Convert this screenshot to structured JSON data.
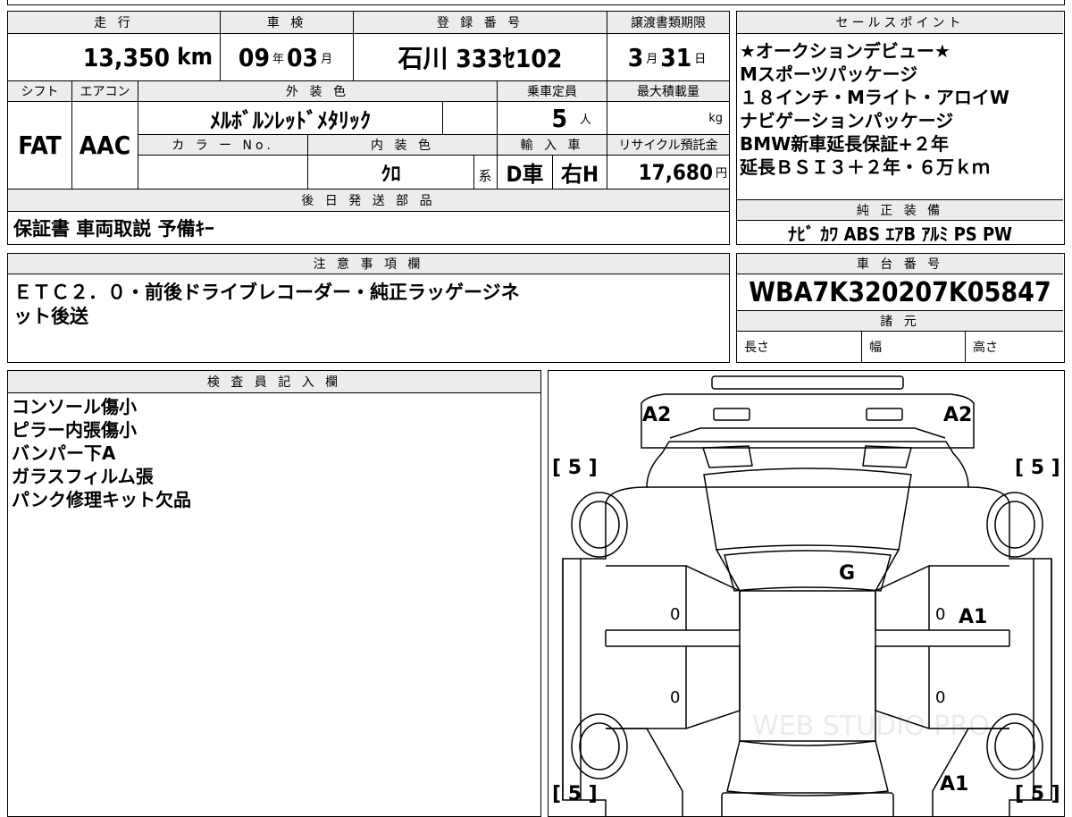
{
  "top_info": {
    "mileage_label": "走 行",
    "mileage_value": "13,350",
    "mileage_unit": "km",
    "inspection_label": "車 検",
    "inspection_year": "09",
    "inspection_year_unit": "年",
    "inspection_month": "03",
    "inspection_month_unit": "月",
    "registration_label": "登 録 番 号",
    "registration_value": "石川 333ｾ102",
    "transfer_deadline_label": "譲渡書類期限",
    "transfer_month": "3",
    "transfer_month_unit": "月",
    "transfer_day": "31",
    "transfer_day_unit": "日"
  },
  "specs": {
    "shift_label": "シフト",
    "shift_value": "FAT",
    "ac_label": "エアコン",
    "ac_value": "AAC",
    "exterior_color_label": "外 装 色",
    "exterior_color_value": "ﾒﾙﾎﾞﾙﾝﾚｯﾄﾞﾒﾀﾘｯｸ",
    "capacity_label": "乗車定員",
    "capacity_value": "5",
    "capacity_unit": "人",
    "max_load_label": "最大積載量",
    "max_load_unit": "kg",
    "color_no_label": "カ ラ ー No.",
    "interior_color_label": "内 装 色",
    "interior_color_value": "ｸﾛ",
    "interior_color_suffix": "系",
    "import_label": "輸 入 車",
    "import_value": "D車",
    "steering_value": "右H",
    "recycle_label": "リサイクル預託金",
    "recycle_value": "17,680",
    "recycle_unit": "円"
  },
  "delivery": {
    "label": "後 日 発 送 部 品",
    "value": "保証書 車両取説 予備ｷｰ"
  },
  "sales_points": {
    "label": "セールスポイント",
    "lines": [
      "★オークションデビュー★",
      "Mスポーツパッケージ",
      "１８インチ・Mライト・アロイW",
      "ナビゲーションパッケージ",
      "BMW新車延長保証+２年",
      "延長ＢＳＩ３＋２年・６万ｋｍ"
    ]
  },
  "genuine_equipment": {
    "label": "純 正 装 備",
    "value": "ﾅﾋﾞ ｶﾜ ABS ｴｱB ｱﾙﾐ PS PW"
  },
  "notes": {
    "label": "注 意 事 項 欄",
    "line1": "ＥＴＣ２．０・前後ドライブレコーダー・純正ラッゲージネ",
    "line2": "ット後送"
  },
  "chassis": {
    "label": "車 台 番 号",
    "value": "WBA7K320207K05847",
    "dims_label": "諸 元",
    "length_label": "長さ",
    "width_label": "幅",
    "height_label": "高さ"
  },
  "inspector": {
    "label": "検 査 員 記 入 欄",
    "lines": [
      "コンソール傷小",
      "ピラー内張傷小",
      "バンパー下A",
      "ガラスフィルム張",
      "パンク修理キット欠品"
    ]
  },
  "diagram": {
    "front_left": "A2",
    "front_right": "A2",
    "tire_fl": "[ 5 ]",
    "tire_fr": "[ 5 ]",
    "tire_rl": "[ 5 ]",
    "tire_rr": "[ 5 ]",
    "windshield": "G",
    "door_fl": "0",
    "door_fr": "0",
    "door_fr_grade": "A1",
    "door_rl": "0",
    "door_rr": "0",
    "rear_right": "A1",
    "watermark": "WEB STUDIO PRO"
  }
}
